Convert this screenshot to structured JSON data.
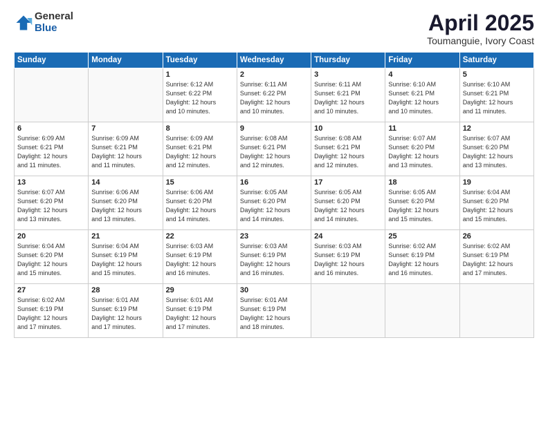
{
  "logo": {
    "general": "General",
    "blue": "Blue"
  },
  "title": "April 2025",
  "subtitle": "Toumanguie, Ivory Coast",
  "weekdays": [
    "Sunday",
    "Monday",
    "Tuesday",
    "Wednesday",
    "Thursday",
    "Friday",
    "Saturday"
  ],
  "weeks": [
    [
      {
        "day": "",
        "info": ""
      },
      {
        "day": "",
        "info": ""
      },
      {
        "day": "1",
        "info": "Sunrise: 6:12 AM\nSunset: 6:22 PM\nDaylight: 12 hours\nand 10 minutes."
      },
      {
        "day": "2",
        "info": "Sunrise: 6:11 AM\nSunset: 6:22 PM\nDaylight: 12 hours\nand 10 minutes."
      },
      {
        "day": "3",
        "info": "Sunrise: 6:11 AM\nSunset: 6:21 PM\nDaylight: 12 hours\nand 10 minutes."
      },
      {
        "day": "4",
        "info": "Sunrise: 6:10 AM\nSunset: 6:21 PM\nDaylight: 12 hours\nand 10 minutes."
      },
      {
        "day": "5",
        "info": "Sunrise: 6:10 AM\nSunset: 6:21 PM\nDaylight: 12 hours\nand 11 minutes."
      }
    ],
    [
      {
        "day": "6",
        "info": "Sunrise: 6:09 AM\nSunset: 6:21 PM\nDaylight: 12 hours\nand 11 minutes."
      },
      {
        "day": "7",
        "info": "Sunrise: 6:09 AM\nSunset: 6:21 PM\nDaylight: 12 hours\nand 11 minutes."
      },
      {
        "day": "8",
        "info": "Sunrise: 6:09 AM\nSunset: 6:21 PM\nDaylight: 12 hours\nand 12 minutes."
      },
      {
        "day": "9",
        "info": "Sunrise: 6:08 AM\nSunset: 6:21 PM\nDaylight: 12 hours\nand 12 minutes."
      },
      {
        "day": "10",
        "info": "Sunrise: 6:08 AM\nSunset: 6:21 PM\nDaylight: 12 hours\nand 12 minutes."
      },
      {
        "day": "11",
        "info": "Sunrise: 6:07 AM\nSunset: 6:20 PM\nDaylight: 12 hours\nand 13 minutes."
      },
      {
        "day": "12",
        "info": "Sunrise: 6:07 AM\nSunset: 6:20 PM\nDaylight: 12 hours\nand 13 minutes."
      }
    ],
    [
      {
        "day": "13",
        "info": "Sunrise: 6:07 AM\nSunset: 6:20 PM\nDaylight: 12 hours\nand 13 minutes."
      },
      {
        "day": "14",
        "info": "Sunrise: 6:06 AM\nSunset: 6:20 PM\nDaylight: 12 hours\nand 13 minutes."
      },
      {
        "day": "15",
        "info": "Sunrise: 6:06 AM\nSunset: 6:20 PM\nDaylight: 12 hours\nand 14 minutes."
      },
      {
        "day": "16",
        "info": "Sunrise: 6:05 AM\nSunset: 6:20 PM\nDaylight: 12 hours\nand 14 minutes."
      },
      {
        "day": "17",
        "info": "Sunrise: 6:05 AM\nSunset: 6:20 PM\nDaylight: 12 hours\nand 14 minutes."
      },
      {
        "day": "18",
        "info": "Sunrise: 6:05 AM\nSunset: 6:20 PM\nDaylight: 12 hours\nand 15 minutes."
      },
      {
        "day": "19",
        "info": "Sunrise: 6:04 AM\nSunset: 6:20 PM\nDaylight: 12 hours\nand 15 minutes."
      }
    ],
    [
      {
        "day": "20",
        "info": "Sunrise: 6:04 AM\nSunset: 6:20 PM\nDaylight: 12 hours\nand 15 minutes."
      },
      {
        "day": "21",
        "info": "Sunrise: 6:04 AM\nSunset: 6:19 PM\nDaylight: 12 hours\nand 15 minutes."
      },
      {
        "day": "22",
        "info": "Sunrise: 6:03 AM\nSunset: 6:19 PM\nDaylight: 12 hours\nand 16 minutes."
      },
      {
        "day": "23",
        "info": "Sunrise: 6:03 AM\nSunset: 6:19 PM\nDaylight: 12 hours\nand 16 minutes."
      },
      {
        "day": "24",
        "info": "Sunrise: 6:03 AM\nSunset: 6:19 PM\nDaylight: 12 hours\nand 16 minutes."
      },
      {
        "day": "25",
        "info": "Sunrise: 6:02 AM\nSunset: 6:19 PM\nDaylight: 12 hours\nand 16 minutes."
      },
      {
        "day": "26",
        "info": "Sunrise: 6:02 AM\nSunset: 6:19 PM\nDaylight: 12 hours\nand 17 minutes."
      }
    ],
    [
      {
        "day": "27",
        "info": "Sunrise: 6:02 AM\nSunset: 6:19 PM\nDaylight: 12 hours\nand 17 minutes."
      },
      {
        "day": "28",
        "info": "Sunrise: 6:01 AM\nSunset: 6:19 PM\nDaylight: 12 hours\nand 17 minutes."
      },
      {
        "day": "29",
        "info": "Sunrise: 6:01 AM\nSunset: 6:19 PM\nDaylight: 12 hours\nand 17 minutes."
      },
      {
        "day": "30",
        "info": "Sunrise: 6:01 AM\nSunset: 6:19 PM\nDaylight: 12 hours\nand 18 minutes."
      },
      {
        "day": "",
        "info": ""
      },
      {
        "day": "",
        "info": ""
      },
      {
        "day": "",
        "info": ""
      }
    ]
  ]
}
